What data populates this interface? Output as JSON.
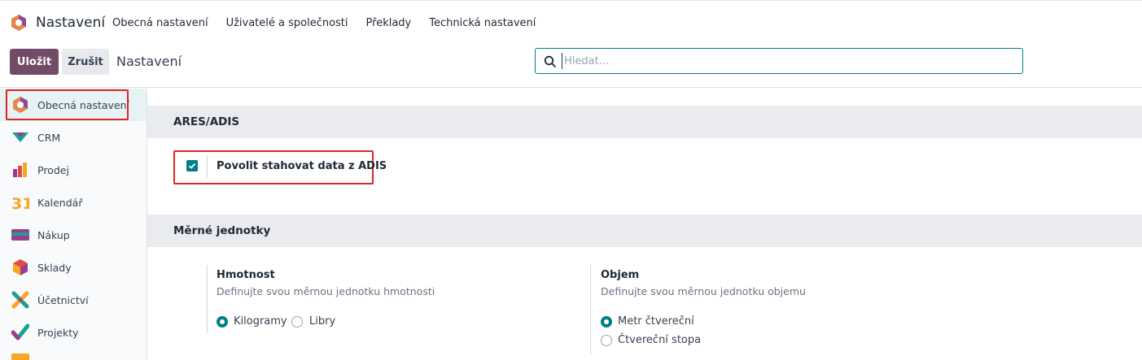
{
  "topnav": {
    "brand": "Nastavení",
    "menu": [
      "Obecná nastavení",
      "Uživatelé a společnosti",
      "Překlady",
      "Technická nastavení"
    ]
  },
  "controlbar": {
    "save_label": "Uložit",
    "cancel_label": "Zrušit",
    "title": "Nastavení",
    "search_placeholder": "Hledat..."
  },
  "sidebar": {
    "items": [
      {
        "label": "Obecná nastavení",
        "icon": "settings-app-icon",
        "active": true
      },
      {
        "label": "CRM",
        "icon": "crm-app-icon"
      },
      {
        "label": "Prodej",
        "icon": "sales-app-icon"
      },
      {
        "label": "Kalendář",
        "icon": "calendar-app-icon"
      },
      {
        "label": "Nákup",
        "icon": "purchase-app-icon"
      },
      {
        "label": "Sklady",
        "icon": "inventory-app-icon"
      },
      {
        "label": "Účetnictví",
        "icon": "accounting-app-icon"
      },
      {
        "label": "Projekty",
        "icon": "project-app-icon"
      }
    ],
    "calendar_digits": "31"
  },
  "main": {
    "ares": {
      "title": "ARES/ADIS",
      "checkbox_label": "Povolit stahovat data z ADIS",
      "checked": true
    },
    "units": {
      "title": "Měrné jednotky",
      "weight": {
        "title": "Hmotnost",
        "description": "Definujte svou měrnou jednotku hmotnosti",
        "options": [
          "Kilogramy",
          "Libry"
        ],
        "selected": "Kilogramy"
      },
      "volume": {
        "title": "Objem",
        "description": "Definujte svou měrnou jednotku objemu",
        "options": [
          "Metr čtvereční",
          "Čtvereční stopa"
        ],
        "selected": "Metr čtvereční"
      }
    }
  },
  "colors": {
    "primary": "#714b67",
    "accent": "#017e84",
    "highlight": "#e02424"
  }
}
